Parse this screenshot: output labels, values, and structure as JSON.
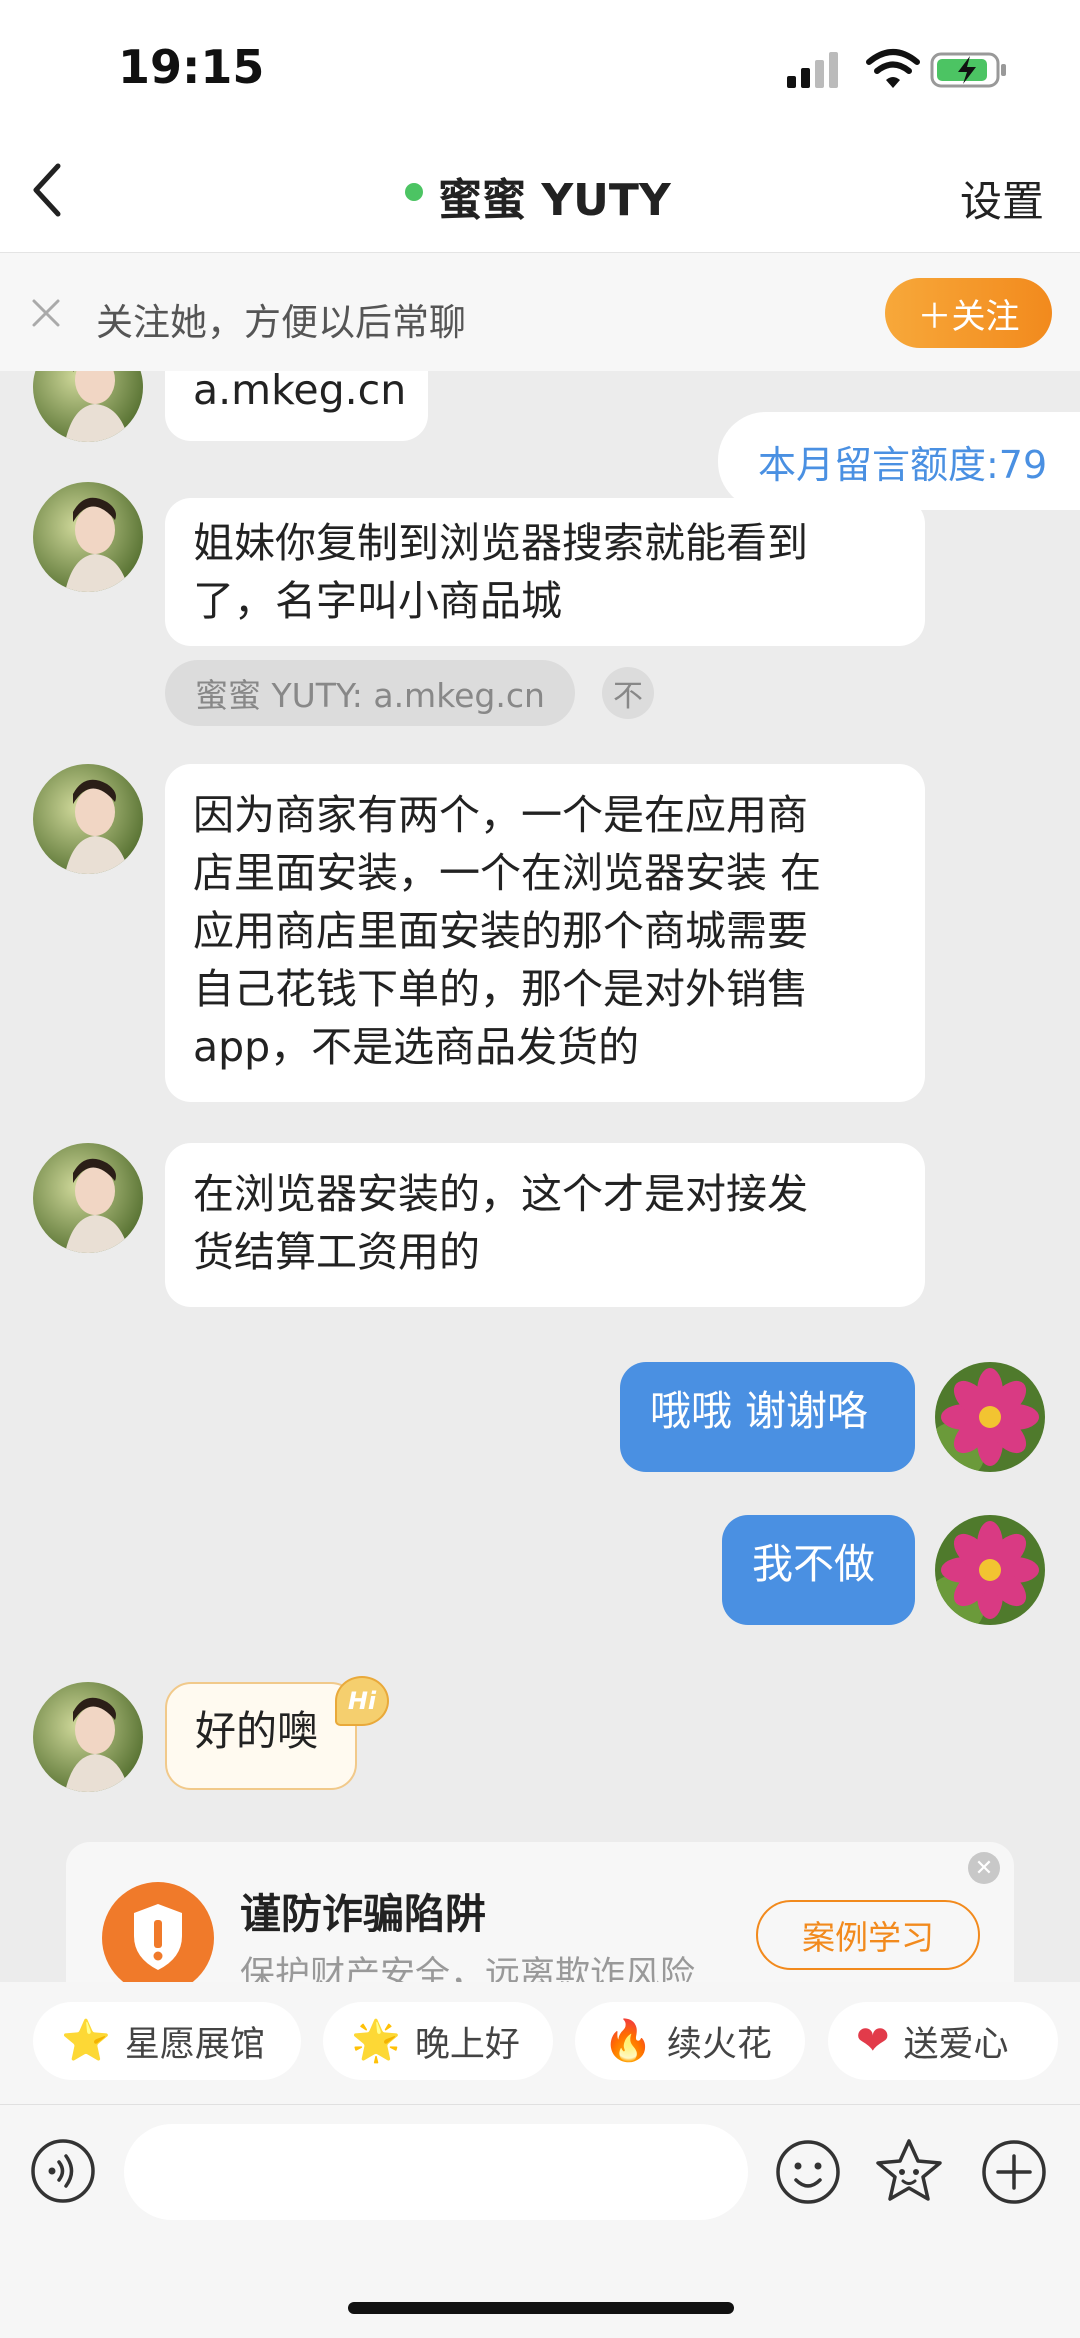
{
  "status": {
    "time": "19:15"
  },
  "header": {
    "title": "蜜蜜 YUTY",
    "settings_label": "设置"
  },
  "follow_banner": {
    "text": "关注她，方便以后常聊",
    "button": "＋关注"
  },
  "quota": "本月留言额度:79",
  "messages": [
    {
      "from": "other",
      "text": "a.mkeg.cn"
    },
    {
      "from": "other",
      "line1": "姐妹你复制到浏览器搜索就能看到",
      "line2": "了，名字叫小商品城"
    },
    {
      "from": "other",
      "line1": "因为商家有两个，一个是在应用商",
      "line2": "店里面安装，一个在浏览器安装 在",
      "line3": "应用商店里面安装的那个商城需要",
      "line4": "自己花钱下单的，那个是对外销售",
      "line5": "app，不是选商品发货的"
    },
    {
      "from": "other",
      "line1": "在浏览器安装的，这个才是对接发",
      "line2": "货结算工资用的"
    },
    {
      "from": "me",
      "text": "哦哦 谢谢咯"
    },
    {
      "from": "me",
      "text": "我不做"
    },
    {
      "from": "other",
      "text": "好的噢",
      "badge": "Hi"
    }
  ],
  "quote": {
    "text": "蜜蜜 YUTY: a.mkeg.cn",
    "up_icon": "不"
  },
  "fraud_card": {
    "title": "谨防诈骗陷阱",
    "subtitle": "保护财产安全，远离欺诈风险",
    "button": "案例学习"
  },
  "quick_chips": [
    {
      "icon": "star-icon",
      "label": "星愿展馆"
    },
    {
      "icon": "smiling-star-icon",
      "label": "晚上好"
    },
    {
      "icon": "fire-icon",
      "label": "续火花"
    },
    {
      "icon": "heart-icon",
      "label": "送爱心"
    }
  ],
  "input": {
    "placeholder": ""
  },
  "colors": {
    "accent_blue": "#4a90e2",
    "accent_orange": "#f28a1d",
    "online_green": "#4cc463"
  }
}
